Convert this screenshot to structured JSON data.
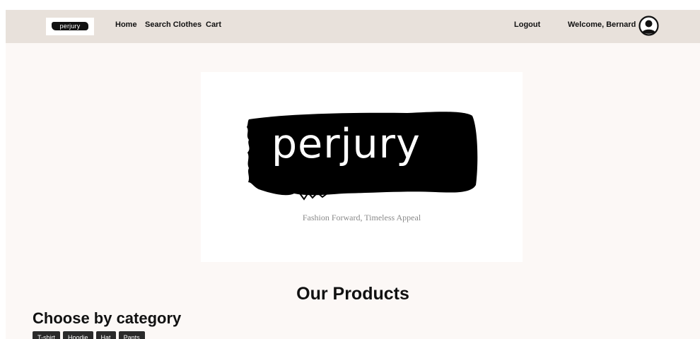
{
  "nav": {
    "logo_text": "perjury",
    "links": [
      "Home",
      "Search Clothes",
      "Cart"
    ],
    "logout": "Logout",
    "welcome": "Welcome, Bernard"
  },
  "hero": {
    "brand": "perjury",
    "tagline": "Fashion Forward, Timeless Appeal"
  },
  "products": {
    "title": "Our Products"
  },
  "categories": {
    "title": "Choose by category",
    "items": [
      "T-shirt",
      "Hoodie",
      "Hat",
      "Pants"
    ]
  },
  "colors": {
    "navbar": "#e8e1db",
    "page": "#fcf8f6",
    "ink": "#111111"
  }
}
